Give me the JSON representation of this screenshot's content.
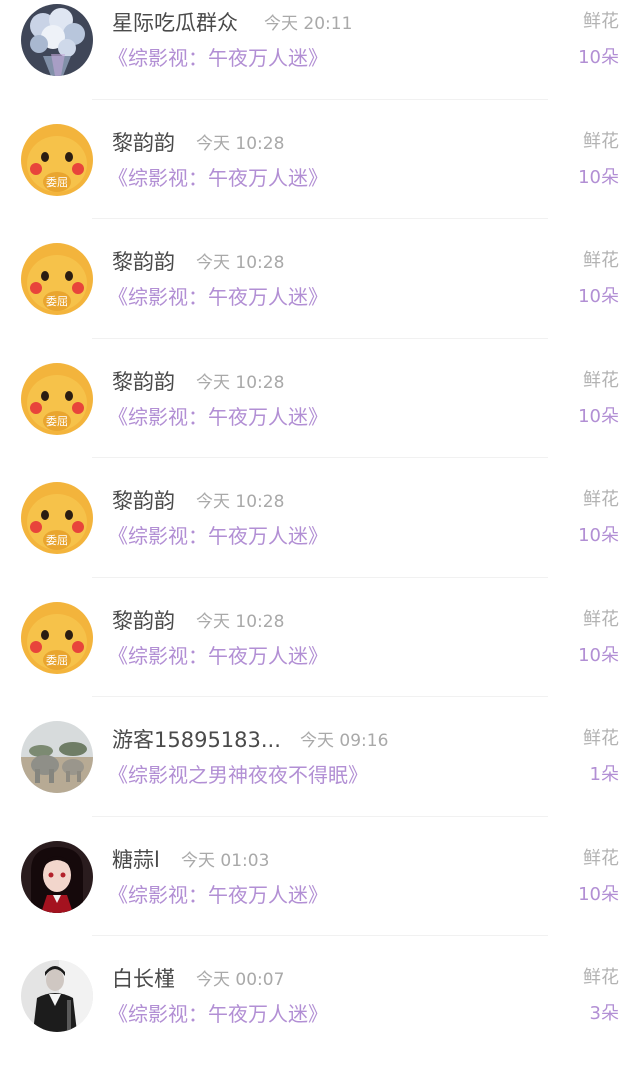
{
  "gift_records": [
    {
      "user": "星际吃瓜群众",
      "time": "今天 20:11",
      "book": "《综影视：午夜万人迷》",
      "gift_type": "鲜花",
      "count": "10朵",
      "avatar_icon": "flower-bouquet-avatar"
    },
    {
      "user": "黎韵韵",
      "time": "今天 10:28",
      "book": "《综影视：午夜万人迷》",
      "gift_type": "鲜花",
      "count": "10朵",
      "avatar_icon": "pikachu-avatar",
      "avatar_text": "委屈"
    },
    {
      "user": "黎韵韵",
      "time": "今天 10:28",
      "book": "《综影视：午夜万人迷》",
      "gift_type": "鲜花",
      "count": "10朵",
      "avatar_icon": "pikachu-avatar",
      "avatar_text": "委屈"
    },
    {
      "user": "黎韵韵",
      "time": "今天 10:28",
      "book": "《综影视：午夜万人迷》",
      "gift_type": "鲜花",
      "count": "10朵",
      "avatar_icon": "pikachu-avatar",
      "avatar_text": "委屈"
    },
    {
      "user": "黎韵韵",
      "time": "今天 10:28",
      "book": "《综影视：午夜万人迷》",
      "gift_type": "鲜花",
      "count": "10朵",
      "avatar_icon": "pikachu-avatar",
      "avatar_text": "委屈"
    },
    {
      "user": "黎韵韵",
      "time": "今天 10:28",
      "book": "《综影视：午夜万人迷》",
      "gift_type": "鲜花",
      "count": "10朵",
      "avatar_icon": "pikachu-avatar",
      "avatar_text": "委屈"
    },
    {
      "user": "游客15895183...",
      "time": "今天 09:16",
      "book": "《综影视之男神夜夜不得眠》",
      "gift_type": "鲜花",
      "count": "1朵",
      "avatar_icon": "stone-elephant-avatar"
    },
    {
      "user": "糖蒜l",
      "time": "今天 01:03",
      "book": "《综影视：午夜万人迷》",
      "gift_type": "鲜花",
      "count": "10朵",
      "avatar_icon": "anime-girl-avatar"
    },
    {
      "user": "白长槿",
      "time": "今天 00:07",
      "book": "《综影视：午夜万人迷》",
      "gift_type": "鲜花",
      "count": "3朵",
      "avatar_icon": "bw-person-avatar"
    }
  ],
  "colors": {
    "accent_purple": "#b28fd4",
    "name_gray": "#4a4a4a",
    "meta_gray": "#a9a9a9"
  }
}
